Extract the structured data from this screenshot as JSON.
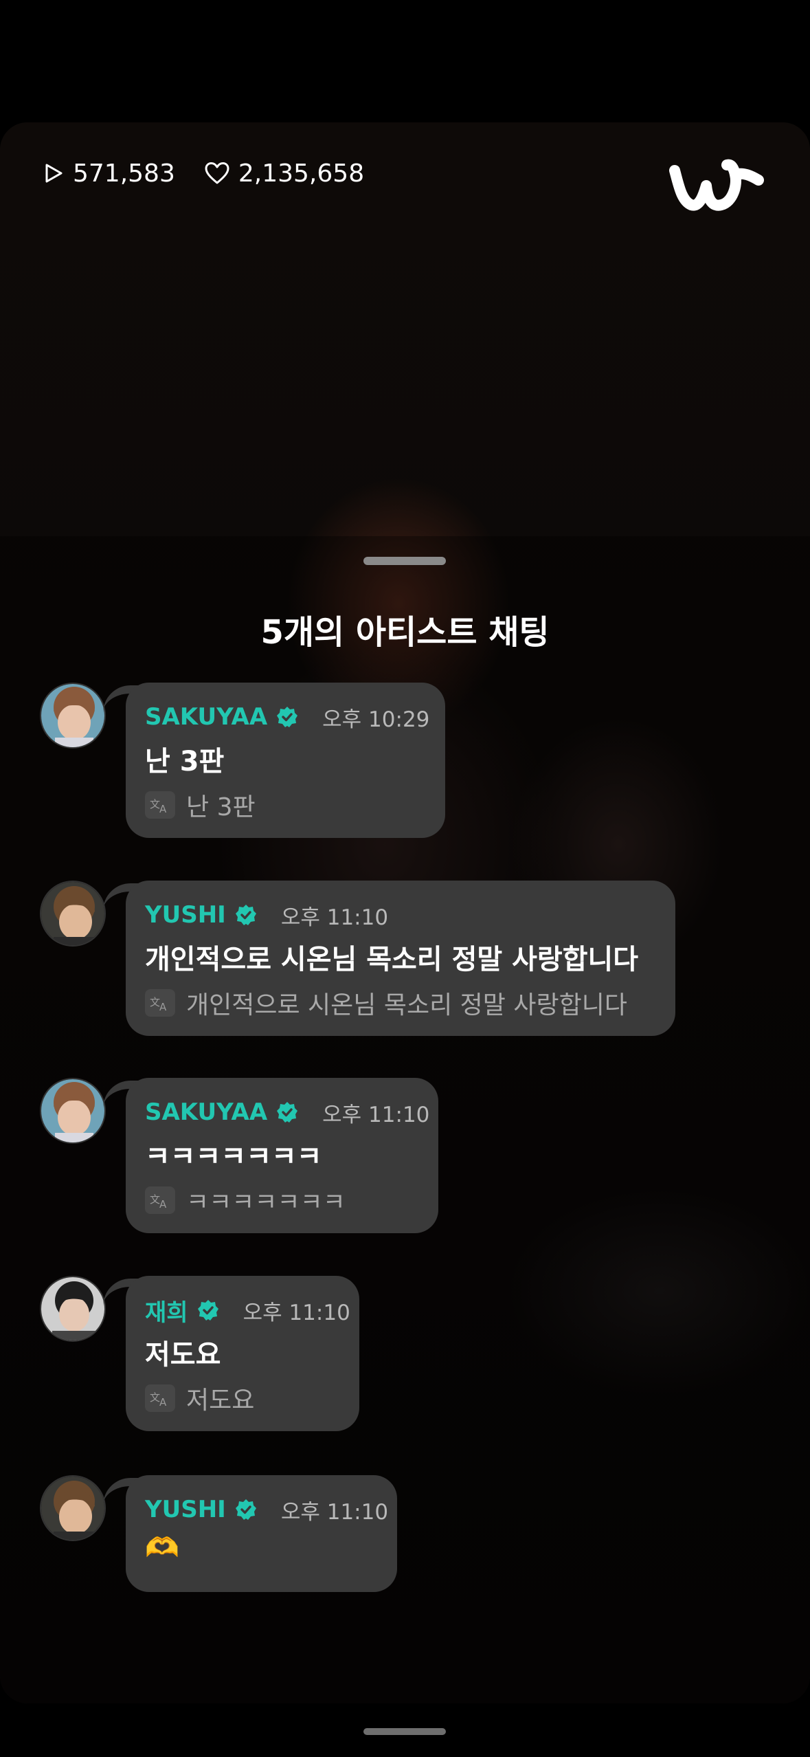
{
  "stats": {
    "plays": "571,583",
    "likes": "2,135,658"
  },
  "colors": {
    "accent": "#22c7b1",
    "bubble": "#3a3a3a",
    "heart": "#6a1a26"
  },
  "sheet": {
    "title": "5개의 아티스트 채팅"
  },
  "messages": [
    {
      "user": "SAKUYAA",
      "time": "오후 10:29",
      "text": "난 3판",
      "translation": "난 3판"
    },
    {
      "user": "YUSHI",
      "time": "오후 11:10",
      "text": "개인적으로 시온님 목소리 정말 사랑합니다",
      "translation": "개인적으로 시온님 목소리 정말 사랑합니다"
    },
    {
      "user": "SAKUYAA",
      "time": "오후 11:10",
      "text": "ㅋㅋㅋㅋㅋㅋㅋ",
      "translation": "ㅋㅋㅋㅋㅋㅋㅋ"
    },
    {
      "user": "재희",
      "time": "오후 11:10",
      "text": "저도요",
      "translation": "저도요"
    },
    {
      "user": "YUSHI",
      "time": "오후 11:10",
      "text": "🫶"
    }
  ]
}
